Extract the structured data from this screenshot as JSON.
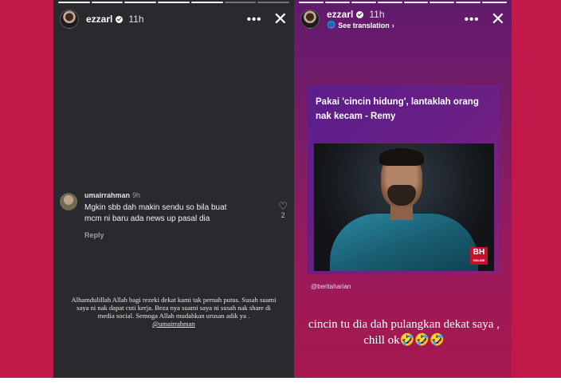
{
  "left_story": {
    "progress": {
      "segments": 7,
      "completed": 5
    },
    "header": {
      "username": "ezzarl",
      "time": "11h"
    },
    "comment": {
      "username": "umairrahman",
      "time": "9h",
      "text": "Mgkin sbb dah makin sendu so bila buat mcm ni baru ada news up pasal dia",
      "reply_label": "Reply",
      "like_count": "2"
    },
    "caption": {
      "text": "Alhamdulillah Allah bagi rezeki dekat kami tak pernah putus. Susah suami saya ni nak dapat cuti kerja. Beza nya suami saya ni susah nak share di media social. Semoga Allah mudahkan urusan adik ya .",
      "tag": "@umairrahman"
    }
  },
  "right_story": {
    "progress": {
      "segments": 8,
      "completed": 8
    },
    "header": {
      "username": "ezzarl",
      "time": "11h",
      "translation_label": "See translation"
    },
    "news": {
      "headline": "Pakai 'cincin hidung', lantaklah orang nak kecam - Remy",
      "logo_main": "BH",
      "logo_sub": "ONLINE",
      "credit": "@beritaharian"
    },
    "story_text": "cincin tu dia dah pulangkan dekat saya , chill ok🤣🤣🤣"
  },
  "icons": {
    "verified": "verified-badge-icon",
    "more": "more-dots-icon",
    "close": "close-icon",
    "like": "heart-icon",
    "translate": "globe-icon"
  },
  "colors": {
    "background": "#c2194a",
    "left_story_bg": "#282a2e",
    "right_story_gradient_top": "#611a6e",
    "right_story_gradient_bottom": "#a8184f"
  }
}
